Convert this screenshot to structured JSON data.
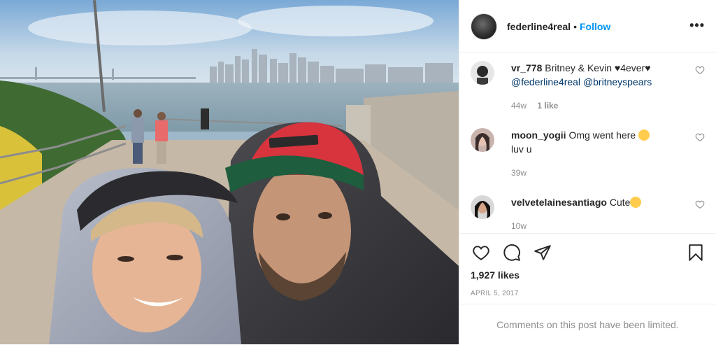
{
  "post": {
    "username": "federline4real",
    "follow_label": "Follow",
    "more_label": "•••"
  },
  "comments": [
    {
      "username": "vr_778",
      "text": "Britney & Kevin ",
      "heart_suffix": "4ever",
      "mention1": "@federline4real",
      "mention2": "@britneyspears",
      "time": "44w",
      "likes": "1 like"
    },
    {
      "username": "moon_yogii",
      "text": "Omg went here ",
      "text2": "luv u",
      "time": "39w"
    },
    {
      "username": "velvetelainesantiago",
      "text": "Cute",
      "time": "10w"
    }
  ],
  "engagement": {
    "likes": "1,927 likes",
    "date": "APRIL 5, 2017"
  },
  "footer": {
    "limited_text": "Comments on this post have been limited."
  },
  "colors": {
    "link": "#0095f6",
    "mention": "#00376b",
    "muted": "#8e8e8e"
  }
}
